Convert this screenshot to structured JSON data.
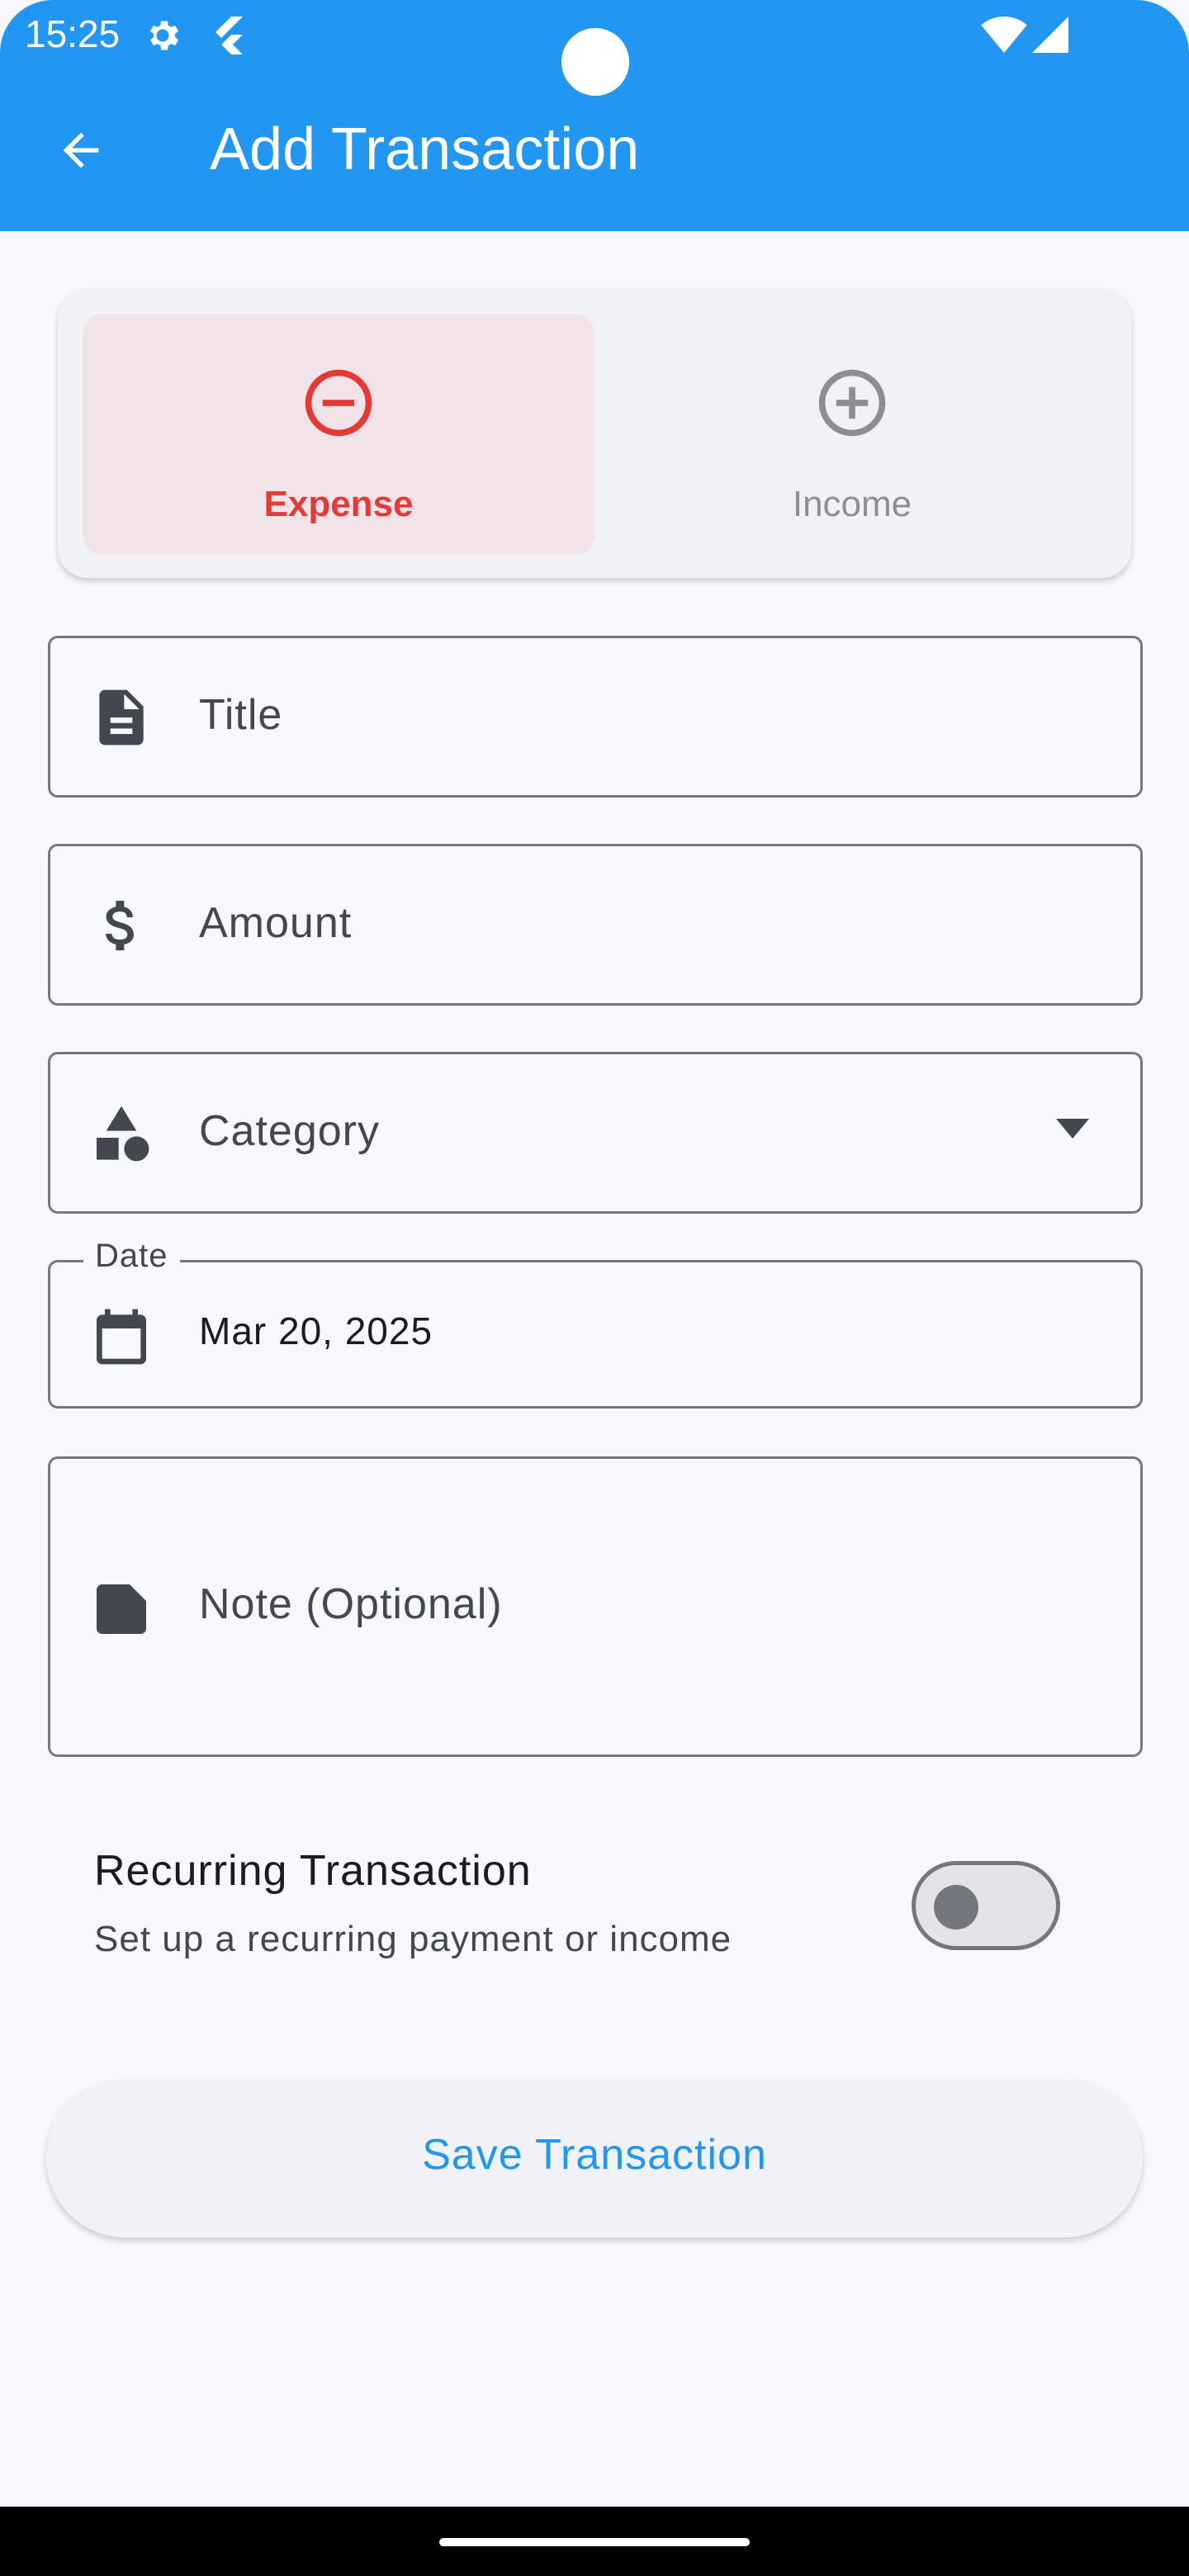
{
  "status_bar": {
    "time": "15:25"
  },
  "app_bar": {
    "title": "Add Transaction"
  },
  "type_toggle": {
    "expense_label": "Expense",
    "income_label": "Income",
    "selected": "Expense"
  },
  "form": {
    "title_label": "Title",
    "amount_label": "Amount",
    "category_label": "Category",
    "date_label": "Date",
    "date_value": "Mar 20, 2025",
    "note_label": "Note (Optional)"
  },
  "recurring": {
    "title": "Recurring Transaction",
    "subtitle": "Set up a recurring payment or income",
    "enabled": false
  },
  "actions": {
    "save_label": "Save Transaction"
  },
  "colors": {
    "primary": "#2196f3",
    "expense_accent": "#e53935",
    "expense_bg": "#f2e3e8",
    "income_muted": "#8e8e92",
    "background": "#f7f8fd"
  }
}
